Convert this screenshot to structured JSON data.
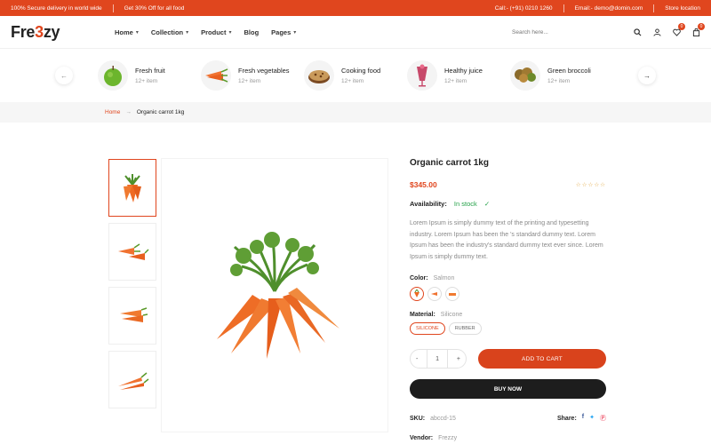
{
  "topbar": {
    "delivery": "100% Secure delivery in world wide",
    "offer": "Get 30% Off for all food",
    "call": "Call:- (+91) 0210 1260",
    "email": "Email:- demo@domin.com",
    "store": "Store location"
  },
  "header": {
    "logo_pre": "Fre",
    "logo_accent": "3",
    "logo_post": "zy",
    "nav": [
      "Home",
      "Collection",
      "Product",
      "Blog",
      "Pages"
    ],
    "search_placeholder": "Search here...",
    "wishlist_count": "0",
    "cart_count": "0"
  },
  "categories": [
    {
      "name": "Fresh fruit",
      "count": "12+ item",
      "icon": "apple-icon"
    },
    {
      "name": "Fresh vegetables",
      "count": "12+ item",
      "icon": "carrot-icon"
    },
    {
      "name": "Cooking food",
      "count": "12+ item",
      "icon": "pie-icon"
    },
    {
      "name": "Healthy juice",
      "count": "12+ item",
      "icon": "juice-icon"
    },
    {
      "name": "Green broccoli",
      "count": "12+ item",
      "icon": "broccoli-icon"
    }
  ],
  "breadcrumb": {
    "home": "Home",
    "current": "Organic carrot 1kg"
  },
  "product": {
    "title": "Organic carrot 1kg",
    "price": "$345.00",
    "availability_label": "Availability:",
    "availability_value": "In stock",
    "description": "Lorem Ipsum is simply dummy text of the printing and typesetting industry. Lorem Ipsum has been the 's standard dummy text. Lorem Ipsum has been the industry's standard dummy text ever since. Lorem Ipsum is simply dummy text.",
    "color_label": "Color:",
    "color_value": "Salmon",
    "material_label": "Material:",
    "material_value": "Silicone",
    "materials": [
      "SILICONE",
      "RUBBER"
    ],
    "qty_minus": "-",
    "qty_value": "1",
    "qty_plus": "+",
    "add_to_cart": "ADD TO CART",
    "buy_now": "BUY NOW",
    "sku_label": "SKU:",
    "sku_value": "abccd-15",
    "share_label": "Share:",
    "vendor_label": "Vendor:",
    "vendor_value": "Frezzy"
  },
  "colors": {
    "accent": "#e0461e",
    "dark": "#1d1d1d",
    "stock_green": "#24a148"
  }
}
